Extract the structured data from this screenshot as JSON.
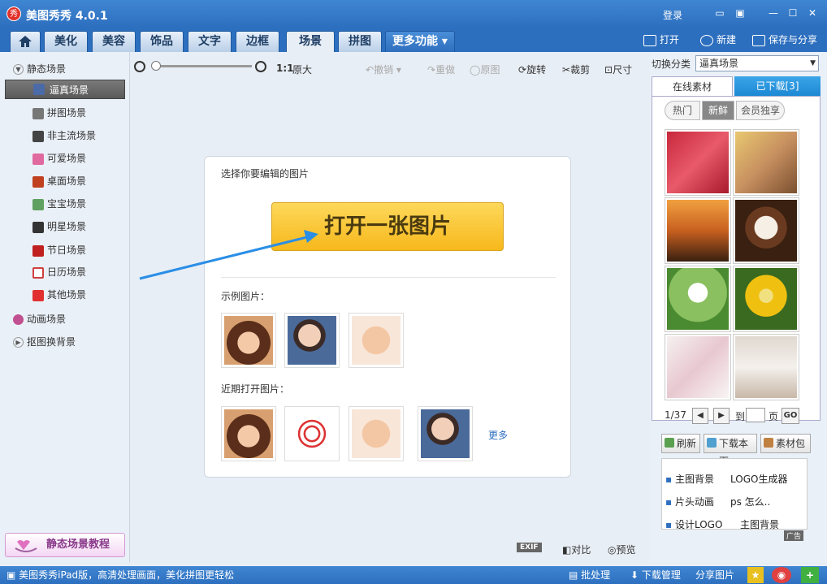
{
  "app": {
    "title": "美图秀秀 4.0.1",
    "logo_text": "秀",
    "login": "登录"
  },
  "tabs": [
    {
      "label": ""
    },
    {
      "label": "美化"
    },
    {
      "label": "美容"
    },
    {
      "label": "饰品"
    },
    {
      "label": "文字"
    },
    {
      "label": "边框"
    },
    {
      "label": "场景"
    },
    {
      "label": "拼图"
    },
    {
      "label": "更多功能"
    }
  ],
  "top_actions": {
    "open": "打开",
    "new": "新建",
    "save_share": "保存与分享"
  },
  "toolbar": {
    "zoom_ratio": "1:1",
    "original_size": "原大",
    "undo": "撤销",
    "redo": "重做",
    "original": "原图",
    "rotate": "旋转",
    "crop": "裁剪",
    "size": "尺寸"
  },
  "sidebar": {
    "static_head": "静态场景",
    "items": [
      {
        "label": "逼真场景",
        "color": "#4a6aa8"
      },
      {
        "label": "拼图场景",
        "color": "#777777"
      },
      {
        "label": "非主流场景",
        "color": "#444444"
      },
      {
        "label": "可爱场景",
        "color": "#e06aa0"
      },
      {
        "label": "桌面场景",
        "color": "#c04020"
      },
      {
        "label": "宝宝场景",
        "color": "#60a060"
      },
      {
        "label": "明星场景",
        "color": "#333333"
      },
      {
        "label": "节日场景",
        "color": "#c02020"
      },
      {
        "label": "日历场景",
        "color": "#d04040"
      },
      {
        "label": "其他场景",
        "color": "#e03030"
      }
    ],
    "anim_head": "动画场景",
    "cutout_head": "抠图换背景",
    "tutorial": "静态场景教程"
  },
  "card": {
    "prompt": "选择你要编辑的图片",
    "open_button": "打开一张图片",
    "samples_label": "示例图片：",
    "recent_label": "近期打开图片：",
    "more": "更多"
  },
  "right": {
    "switch_label": "切换分类",
    "category": "逼真场景",
    "tab_online": "在线素材",
    "tab_downloaded": "已下载[3]",
    "filter_hot": "热门",
    "filter_fresh": "新鲜",
    "filter_member": "会员独享",
    "page_current": "1/37",
    "goto": "到",
    "page_unit": "页",
    "go": "GO",
    "refresh": "刷新",
    "download_page": "下载本页",
    "material_pack": "素材包",
    "ads": [
      "主图背景",
      "LOGO生成器",
      "片头动画",
      "ps 怎么..",
      "设计LOGO",
      "主图背景"
    ],
    "ad_tag": "广告"
  },
  "bottom": {
    "exif": "EXIF",
    "compare": "对比",
    "preview": "预览"
  },
  "status": {
    "promo": "美图秀秀iPad版，高清处理画面，美化拼图更轻松",
    "batch": "批处理",
    "download_mgr": "下载管理",
    "share": "分享图片"
  },
  "colors": {
    "accent": "#2d6fbf",
    "button_yellow": "#f7b81c"
  }
}
